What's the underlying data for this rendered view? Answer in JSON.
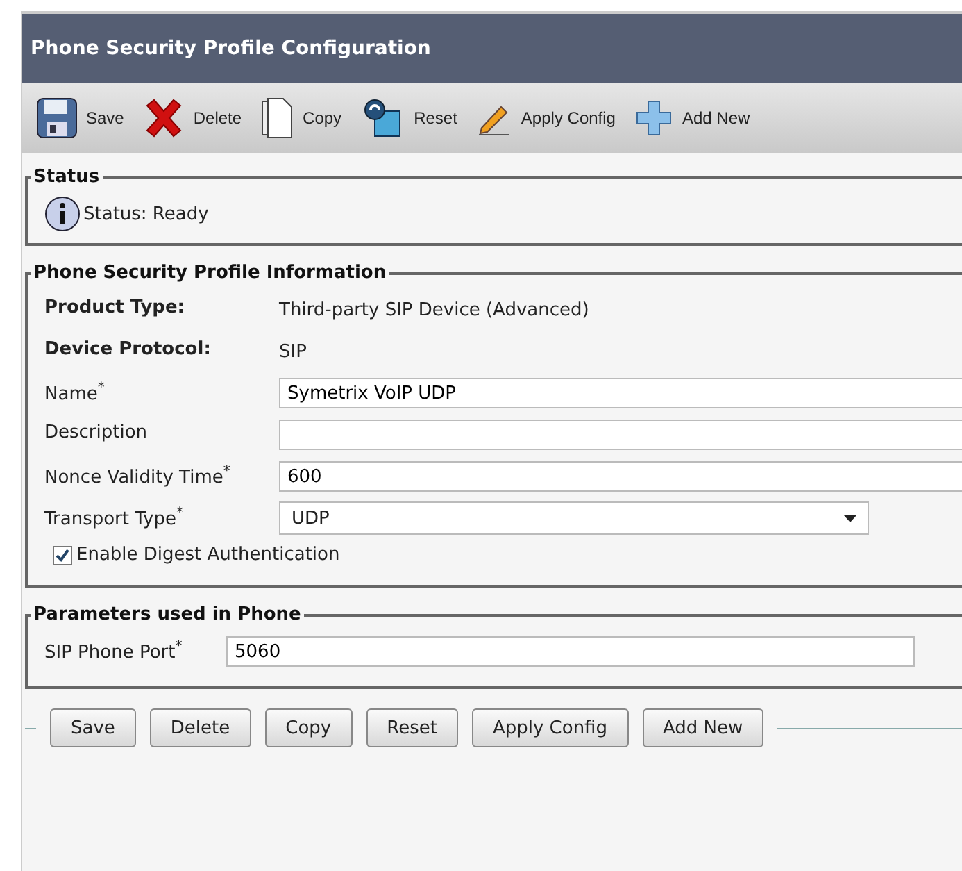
{
  "title": "Phone Security Profile Configuration",
  "toolbar": [
    {
      "kind": "save",
      "label": "Save"
    },
    {
      "kind": "delete",
      "label": "Delete"
    },
    {
      "kind": "copy",
      "label": "Copy"
    },
    {
      "kind": "reset",
      "label": "Reset"
    },
    {
      "kind": "apply",
      "label": "Apply Config"
    },
    {
      "kind": "add",
      "label": "Add New"
    }
  ],
  "status": {
    "legend": "Status",
    "text": "Status: Ready"
  },
  "info": {
    "legend": "Phone Security Profile Information",
    "rows": [
      {
        "kind": "static",
        "label": "Product Type:",
        "value": "Third-party SIP Device (Advanced)"
      },
      {
        "kind": "static",
        "label": "Device Protocol:",
        "value": "SIP"
      },
      {
        "kind": "input",
        "label": "Name$^{*}$",
        "value": "Symetrix VoIP UDP"
      },
      {
        "kind": "input",
        "label": "Description"
      },
      {
        "kind": "input",
        "label": "Nonce Validity Time$^{*}$",
        "value": "600"
      },
      {
        "kind": "select",
        "label": "Transport Type$^{*}$",
        "value": "UDP"
      }
    ],
    "checkbox": {
      "label": "Enable Digest Authentication",
      "checked": true
    }
  },
  "params": {
    "legend": "Parameters used in Phone",
    "rows": [
      {
        "kind": "input",
        "label": "SIP Phone Port$^{*}$",
        "value": "5060"
      }
    ]
  },
  "buttons": [
    "Save",
    "Delete",
    "Copy",
    "Reset",
    "Apply Config",
    "Add New"
  ]
}
